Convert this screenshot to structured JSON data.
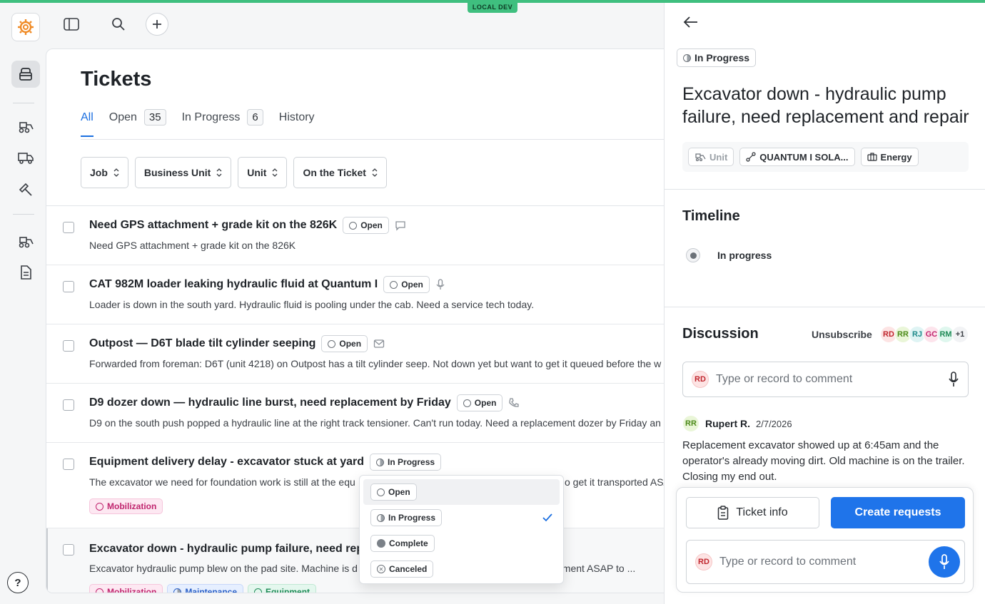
{
  "env_badge": "LOCAL DEV",
  "page": {
    "title": "Tickets",
    "tabs": [
      {
        "label": "All",
        "count": null
      },
      {
        "label": "Open",
        "count": "35"
      },
      {
        "label": "In Progress",
        "count": "6"
      },
      {
        "label": "History",
        "count": null
      }
    ],
    "filters": [
      "Job",
      "Business Unit",
      "Unit",
      "On the Ticket"
    ]
  },
  "tickets": [
    {
      "title": "Need GPS attachment + grade kit on the 826K",
      "status": "Open",
      "channel": "chat-icon",
      "desc": "Need GPS attachment + grade kit on the 826K"
    },
    {
      "title": "CAT 982M loader leaking hydraulic fluid at Quantum I",
      "status": "Open",
      "channel": "mic-icon",
      "desc": "Loader is down in the south yard. Hydraulic fluid is pooling under the cab. Need a service tech today."
    },
    {
      "title": "Outpost — D6T blade tilt cylinder seeping",
      "status": "Open",
      "channel": "mail-icon",
      "desc": "Forwarded from foreman: D6T (unit 4218) on Outpost has a tilt cylinder seep. Not down yet but want to get it queued before the w"
    },
    {
      "title": "D9 dozer down — hydraulic line burst, need replacement by Friday",
      "status": "Open",
      "channel": "phone-icon",
      "desc": "D9 on the south push popped a hydraulic line at the right track tensioner. Can't run today. Need a replacement dozer by Friday an"
    },
    {
      "title": "Equipment delivery delay - excavator stuck at yard",
      "status": "In Progress",
      "desc_left": "The excavator we need for foundation work is still at the equ",
      "desc_right": "o get it transported ASA",
      "tags": [
        "Mobilization"
      ]
    },
    {
      "title": "Excavator down - hydraulic pump failure, need repla",
      "desc_left": "Excavator hydraulic pump blew on the pad site. Machine is d",
      "desc_right": "ement ASAP to ...",
      "tags": [
        "Mobilization",
        "Maintenance",
        "Equipment"
      ]
    }
  ],
  "status_menu": {
    "options": [
      "Open",
      "In Progress",
      "Complete",
      "Canceled"
    ],
    "selected": "In Progress"
  },
  "detail": {
    "status": "In Progress",
    "title": "Excavator down - hydraulic pump failure, need replacement and repair",
    "chips": [
      "Unit",
      "QUANTUM I SOLA...",
      "Energy"
    ],
    "timeline_heading": "Timeline",
    "timeline": [
      {
        "label": "In progress"
      }
    ],
    "discussion_heading": "Discussion",
    "unsubscribe": "Unsubscribe",
    "avatars": [
      {
        "initials": "RD",
        "bg": "#fde4e4",
        "fg": "#c0262d"
      },
      {
        "initials": "RR",
        "bg": "#eaf6d8",
        "fg": "#4c8a1a"
      },
      {
        "initials": "RJ",
        "bg": "#dff4f4",
        "fg": "#1f8b8b"
      },
      {
        "initials": "GC",
        "bg": "#fde4ec",
        "fg": "#c0266f"
      },
      {
        "initials": "RM",
        "bg": "#dff7ee",
        "fg": "#1f8b57"
      }
    ],
    "avatars_more": "+1",
    "comment_avatar": "RD",
    "comment_placeholder": "Type or record to comment",
    "message": {
      "initials": "RR",
      "author": "Rupert R.",
      "date": "2/7/2026",
      "body": "Replacement excavator showed up at 6:45am and the operator's already moving dirt. Old machine is on the trailer. Closing my end out."
    },
    "ticket_info_label": "Ticket info",
    "create_requests_label": "Create requests",
    "bottom_comment_avatar": "RD",
    "bottom_comment_placeholder": "Type or record to comment"
  },
  "colors": {
    "accent": "#1f74ea",
    "env": "#3fbf7f"
  }
}
